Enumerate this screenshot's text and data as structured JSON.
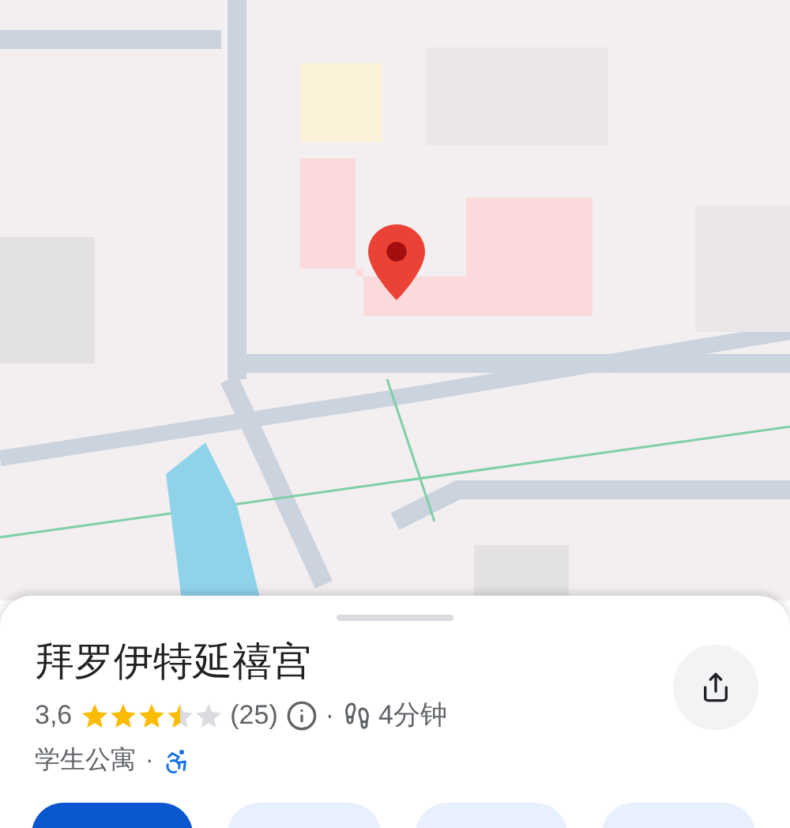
{
  "place": {
    "title": "拜罗伊特延禧宫",
    "rating": "3,6",
    "stars": 3.5,
    "reviews": "(25)",
    "separator": "·",
    "walk_time": "4分钟",
    "category": "学生公寓",
    "separator_2": "·"
  },
  "action_buttons": [
    {
      "kind": "primary"
    },
    {
      "kind": "secondary"
    },
    {
      "kind": "secondary"
    },
    {
      "kind": "secondary"
    }
  ]
}
